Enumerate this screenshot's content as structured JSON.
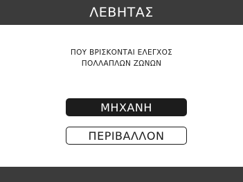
{
  "header": {
    "title": "ΛΕΒΗΤΑΣ"
  },
  "prompt": {
    "line1": "ΠΟΥ ΒΡΙΣΚΟΝΤΑΙ ΕΛΕΓΧΟΣ",
    "line2": "ΠΟΛΛΑΠΛΩΝ ΖΩΝΩΝ"
  },
  "options": [
    {
      "label": "ΜΗΧΑΝΗ",
      "selected": true
    },
    {
      "label": "ΠΕΡΙΒΑΛΛΟΝ",
      "selected": false
    }
  ],
  "colors": {
    "bar": "#3b3b3b",
    "selected_bg": "#1c1c1c",
    "background": "#ffffff"
  }
}
